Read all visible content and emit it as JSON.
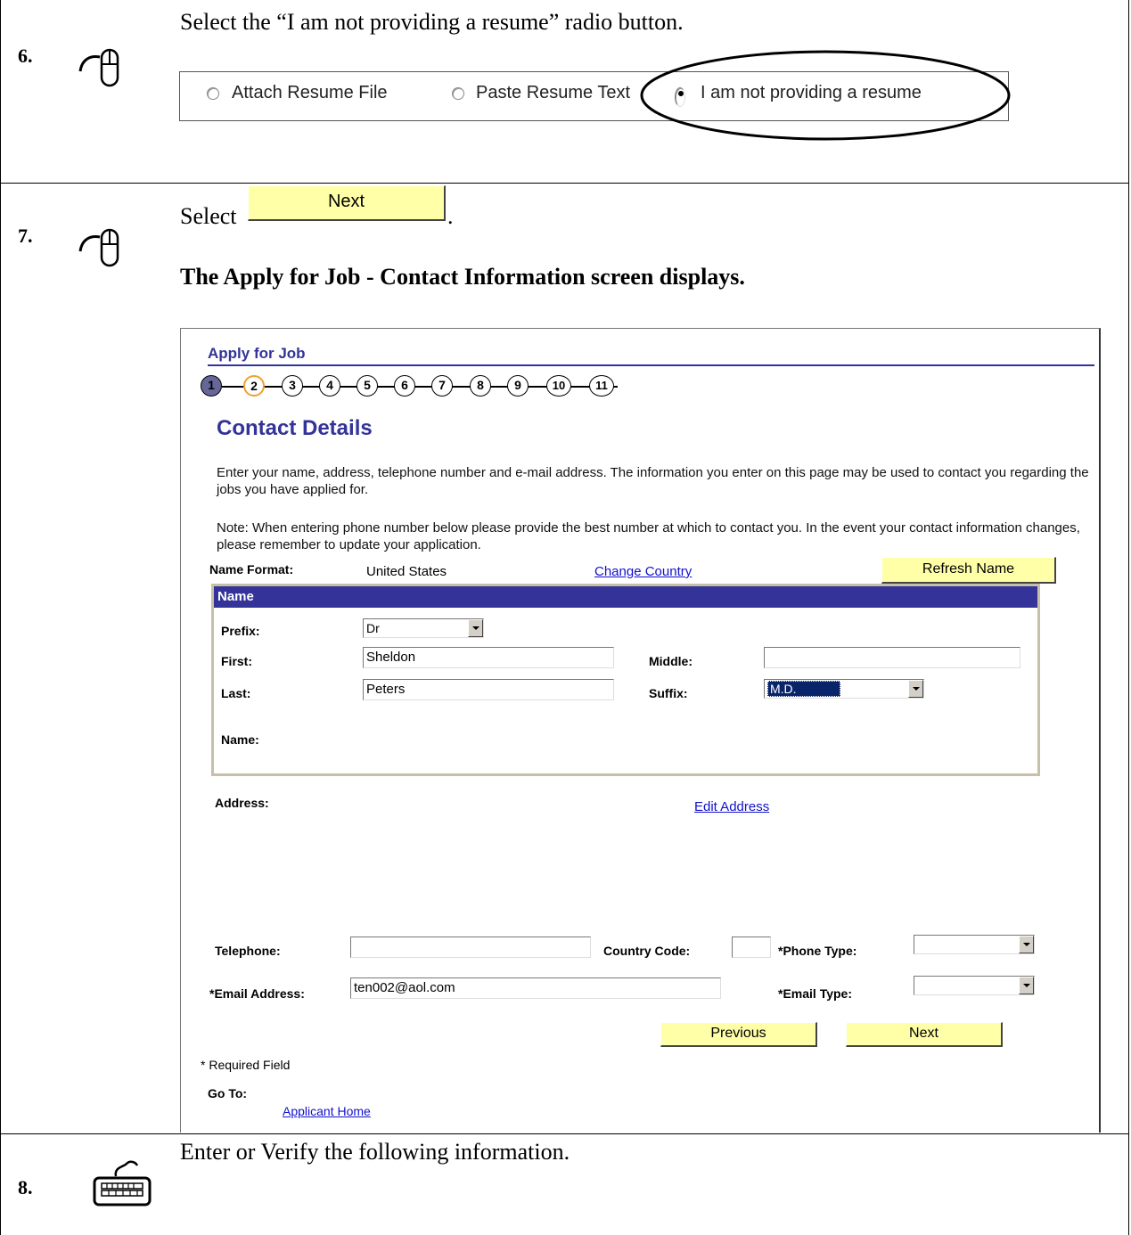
{
  "steps": [
    {
      "number": "6.",
      "icon": "mouse-icon",
      "instruction": "Select the “I am not providing a resume” radio button."
    },
    {
      "number": "7.",
      "icon": "mouse-icon",
      "instruction_prefix": "Select",
      "instruction_button": "Next",
      "instruction_suffix": ".",
      "result": "The Apply for Job - Contact Information screen displays."
    },
    {
      "number": "8.",
      "icon": "keyboard-icon",
      "instruction": "Enter or Verify the following information."
    }
  ],
  "resume_options": [
    {
      "label": "Attach Resume File",
      "selected": false
    },
    {
      "label": "Paste Resume Text",
      "selected": false
    },
    {
      "label": "I am not providing a resume",
      "selected": true
    }
  ],
  "screen": {
    "title": "Apply for Job",
    "steps": [
      "1",
      "2",
      "3",
      "4",
      "5",
      "6",
      "7",
      "8",
      "9",
      "10",
      "11"
    ],
    "current_step": 2,
    "heading": "Contact Details",
    "intro": "Enter your name, address, telephone number and e-mail address. The information you enter on this page may be used to contact you regarding the jobs you have applied for.",
    "note": "Note: When entering phone number below please provide the best number at which to contact you.  In the event your contact information changes, please remember to update your application.",
    "name_format_label": "Name Format:",
    "name_format_value": "United States",
    "change_country_link": "Change Country",
    "refresh_name_button": "Refresh Name",
    "name_section": {
      "header": "Name",
      "prefix_label": "Prefix:",
      "prefix_value": "Dr",
      "first_label": "First:",
      "first_value": "Sheldon",
      "middle_label": "Middle:",
      "middle_value": "",
      "last_label": "Last:",
      "last_value": "Peters",
      "suffix_label": "Suffix:",
      "suffix_value": "M.D.",
      "name_label": "Name:"
    },
    "address_label": "Address:",
    "edit_address_link": "Edit Address",
    "telephone_label": "Telephone:",
    "telephone_value": "",
    "country_code_label": "Country Code:",
    "country_code_value": "",
    "phone_type_label": "*Phone Type:",
    "phone_type_value": "",
    "email_label": "*Email Address:",
    "email_value": "ten002@aol.com",
    "email_type_label": "*Email Type:",
    "email_type_value": "",
    "previous_button": "Previous",
    "next_button": "Next",
    "required_note": "* Required Field",
    "goto_label": "Go To:",
    "applicant_home_link": "Applicant Home"
  }
}
